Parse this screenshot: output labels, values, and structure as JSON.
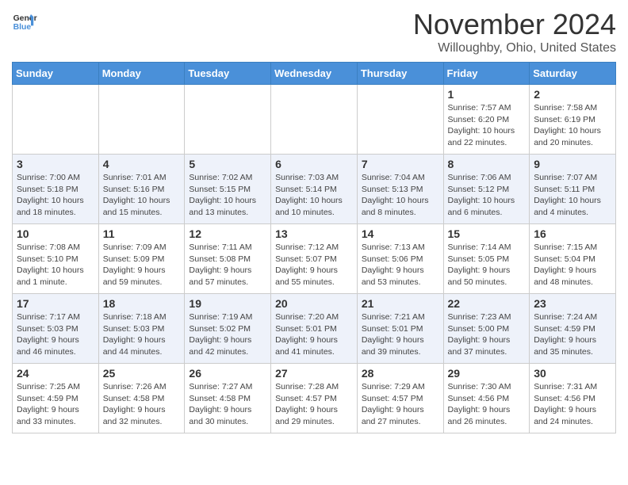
{
  "header": {
    "logo_line1": "General",
    "logo_line2": "Blue",
    "month": "November 2024",
    "location": "Willoughby, Ohio, United States"
  },
  "weekdays": [
    "Sunday",
    "Monday",
    "Tuesday",
    "Wednesday",
    "Thursday",
    "Friday",
    "Saturday"
  ],
  "weeks": [
    [
      {
        "day": "",
        "info": ""
      },
      {
        "day": "",
        "info": ""
      },
      {
        "day": "",
        "info": ""
      },
      {
        "day": "",
        "info": ""
      },
      {
        "day": "",
        "info": ""
      },
      {
        "day": "1",
        "info": "Sunrise: 7:57 AM\nSunset: 6:20 PM\nDaylight: 10 hours and 22 minutes."
      },
      {
        "day": "2",
        "info": "Sunrise: 7:58 AM\nSunset: 6:19 PM\nDaylight: 10 hours and 20 minutes."
      }
    ],
    [
      {
        "day": "3",
        "info": "Sunrise: 7:00 AM\nSunset: 5:18 PM\nDaylight: 10 hours and 18 minutes."
      },
      {
        "day": "4",
        "info": "Sunrise: 7:01 AM\nSunset: 5:16 PM\nDaylight: 10 hours and 15 minutes."
      },
      {
        "day": "5",
        "info": "Sunrise: 7:02 AM\nSunset: 5:15 PM\nDaylight: 10 hours and 13 minutes."
      },
      {
        "day": "6",
        "info": "Sunrise: 7:03 AM\nSunset: 5:14 PM\nDaylight: 10 hours and 10 minutes."
      },
      {
        "day": "7",
        "info": "Sunrise: 7:04 AM\nSunset: 5:13 PM\nDaylight: 10 hours and 8 minutes."
      },
      {
        "day": "8",
        "info": "Sunrise: 7:06 AM\nSunset: 5:12 PM\nDaylight: 10 hours and 6 minutes."
      },
      {
        "day": "9",
        "info": "Sunrise: 7:07 AM\nSunset: 5:11 PM\nDaylight: 10 hours and 4 minutes."
      }
    ],
    [
      {
        "day": "10",
        "info": "Sunrise: 7:08 AM\nSunset: 5:10 PM\nDaylight: 10 hours and 1 minute."
      },
      {
        "day": "11",
        "info": "Sunrise: 7:09 AM\nSunset: 5:09 PM\nDaylight: 9 hours and 59 minutes."
      },
      {
        "day": "12",
        "info": "Sunrise: 7:11 AM\nSunset: 5:08 PM\nDaylight: 9 hours and 57 minutes."
      },
      {
        "day": "13",
        "info": "Sunrise: 7:12 AM\nSunset: 5:07 PM\nDaylight: 9 hours and 55 minutes."
      },
      {
        "day": "14",
        "info": "Sunrise: 7:13 AM\nSunset: 5:06 PM\nDaylight: 9 hours and 53 minutes."
      },
      {
        "day": "15",
        "info": "Sunrise: 7:14 AM\nSunset: 5:05 PM\nDaylight: 9 hours and 50 minutes."
      },
      {
        "day": "16",
        "info": "Sunrise: 7:15 AM\nSunset: 5:04 PM\nDaylight: 9 hours and 48 minutes."
      }
    ],
    [
      {
        "day": "17",
        "info": "Sunrise: 7:17 AM\nSunset: 5:03 PM\nDaylight: 9 hours and 46 minutes."
      },
      {
        "day": "18",
        "info": "Sunrise: 7:18 AM\nSunset: 5:03 PM\nDaylight: 9 hours and 44 minutes."
      },
      {
        "day": "19",
        "info": "Sunrise: 7:19 AM\nSunset: 5:02 PM\nDaylight: 9 hours and 42 minutes."
      },
      {
        "day": "20",
        "info": "Sunrise: 7:20 AM\nSunset: 5:01 PM\nDaylight: 9 hours and 41 minutes."
      },
      {
        "day": "21",
        "info": "Sunrise: 7:21 AM\nSunset: 5:01 PM\nDaylight: 9 hours and 39 minutes."
      },
      {
        "day": "22",
        "info": "Sunrise: 7:23 AM\nSunset: 5:00 PM\nDaylight: 9 hours and 37 minutes."
      },
      {
        "day": "23",
        "info": "Sunrise: 7:24 AM\nSunset: 4:59 PM\nDaylight: 9 hours and 35 minutes."
      }
    ],
    [
      {
        "day": "24",
        "info": "Sunrise: 7:25 AM\nSunset: 4:59 PM\nDaylight: 9 hours and 33 minutes."
      },
      {
        "day": "25",
        "info": "Sunrise: 7:26 AM\nSunset: 4:58 PM\nDaylight: 9 hours and 32 minutes."
      },
      {
        "day": "26",
        "info": "Sunrise: 7:27 AM\nSunset: 4:58 PM\nDaylight: 9 hours and 30 minutes."
      },
      {
        "day": "27",
        "info": "Sunrise: 7:28 AM\nSunset: 4:57 PM\nDaylight: 9 hours and 29 minutes."
      },
      {
        "day": "28",
        "info": "Sunrise: 7:29 AM\nSunset: 4:57 PM\nDaylight: 9 hours and 27 minutes."
      },
      {
        "day": "29",
        "info": "Sunrise: 7:30 AM\nSunset: 4:56 PM\nDaylight: 9 hours and 26 minutes."
      },
      {
        "day": "30",
        "info": "Sunrise: 7:31 AM\nSunset: 4:56 PM\nDaylight: 9 hours and 24 minutes."
      }
    ]
  ]
}
